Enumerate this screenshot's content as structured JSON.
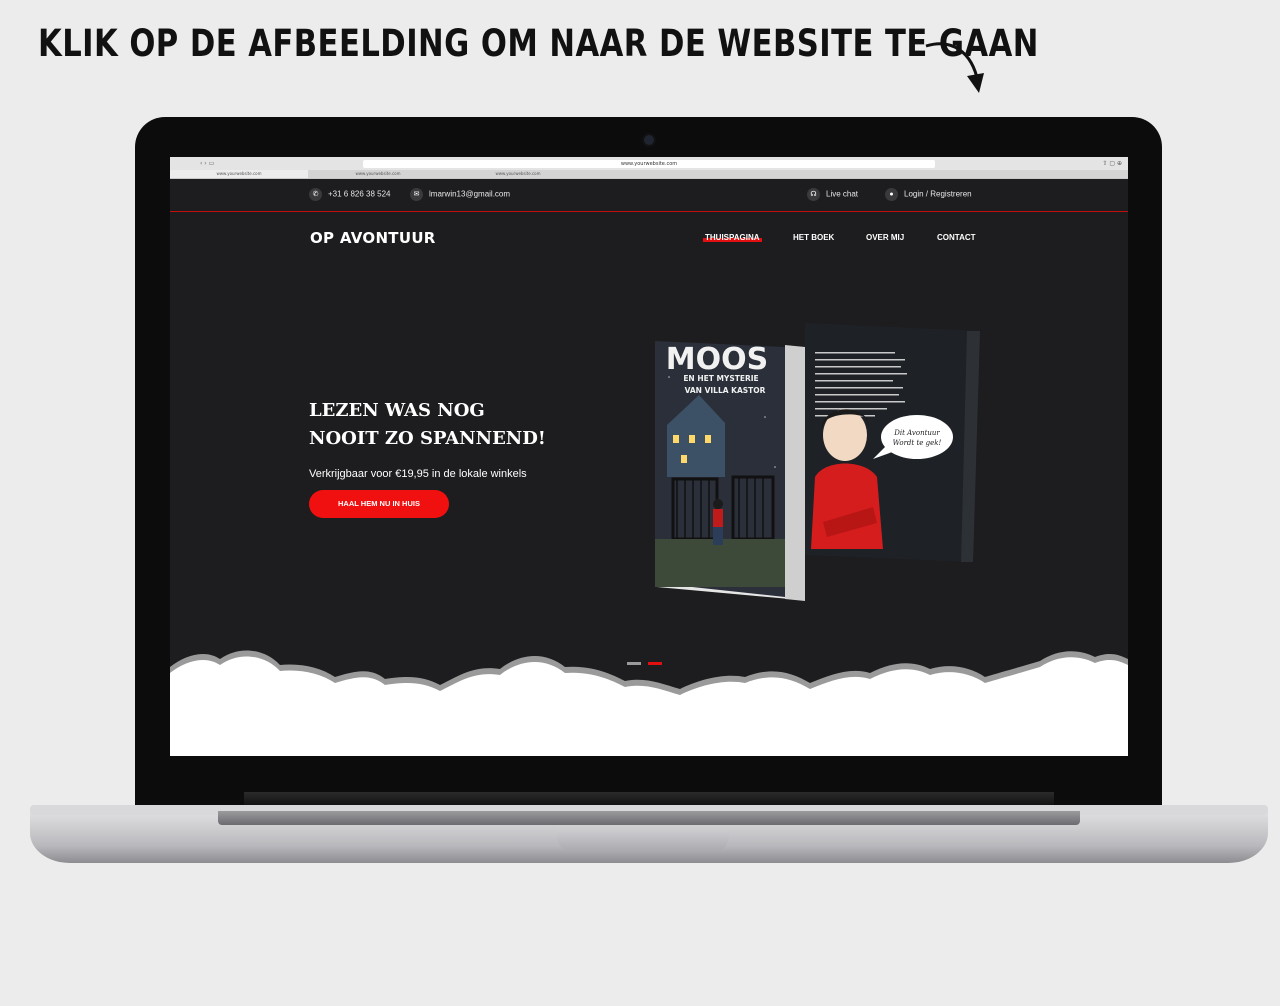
{
  "banner": {
    "text": "KLIK OP DE AFBEELDING OM NAAR DE WEBSITE TE GAAN"
  },
  "browser": {
    "url": "www.yourwebsite.com",
    "tabs": [
      "www.yourwebsite.com",
      "www.yourwebsite.com",
      "www.yourwebsite.com"
    ]
  },
  "topbar": {
    "phone": "+31 6 826 38 524",
    "email": "lmarwin13@gmail.com",
    "live_chat": "Live chat",
    "login": "Login / Registreren"
  },
  "site": {
    "logo": "OP AVONTUUR",
    "nav": [
      "THUISPAGINA",
      "HET BOEK",
      "OVER MIJ",
      "CONTACT"
    ],
    "active_nav": "THUISPAGINA"
  },
  "hero": {
    "title_line1": "LEZEN WAS NOG",
    "title_line2": "NOOIT ZO SPANNEND!",
    "subtitle": "Verkrijgbaar voor €19,95 in de lokale winkels",
    "cta": "HAAL HEM NU IN HUIS"
  },
  "book": {
    "title": "MOOS",
    "subtitle_line1": "EN HET MYSTERIE",
    "subtitle_line2": "VAN VILLA KASTOR",
    "speech_line1": "Dit Avontuur",
    "speech_line2": "Wordt te gek!"
  },
  "slider": {
    "slides": 2,
    "active_index": 1
  },
  "colors": {
    "accent": "#e10f0f",
    "page_bg": "#1d1d1f",
    "backdrop": "#ececec"
  }
}
